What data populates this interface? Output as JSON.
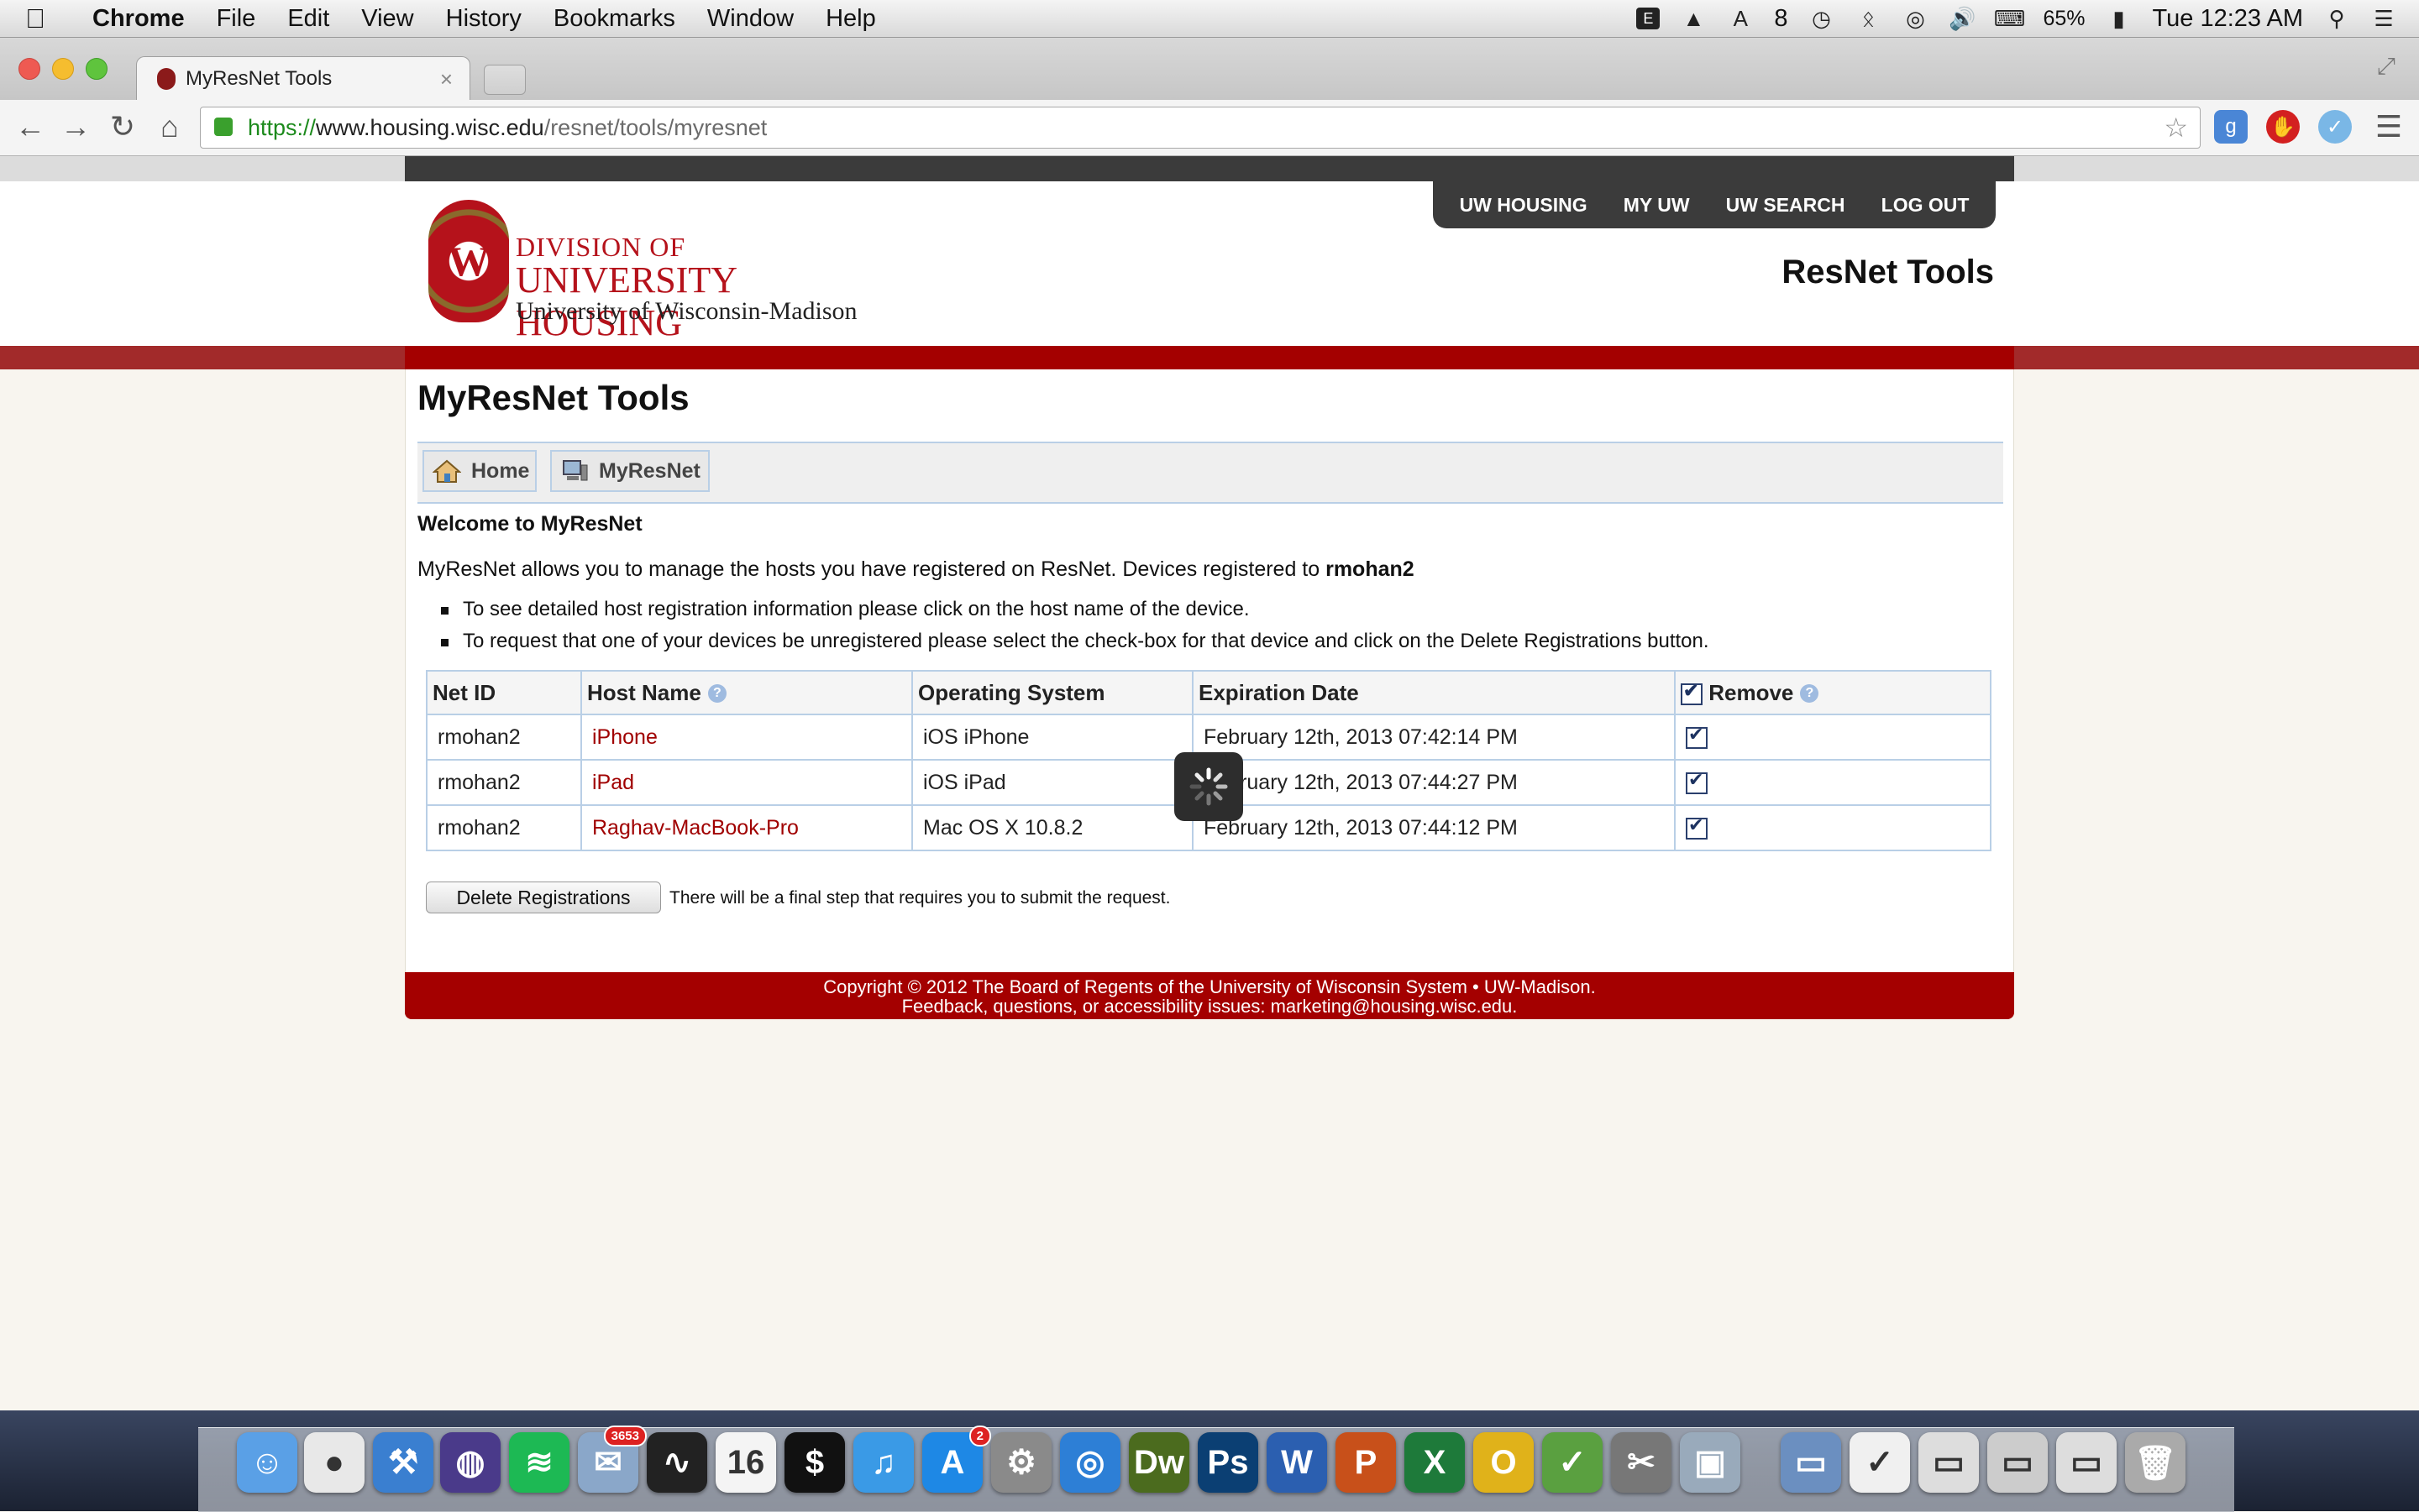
{
  "menubar": {
    "app_name": "Chrome",
    "items": [
      "File",
      "Edit",
      "View",
      "History",
      "Bookmarks",
      "Window",
      "Help"
    ],
    "status": {
      "notif_count": "8",
      "battery": "65%",
      "clock": "Tue 12:23 AM"
    }
  },
  "browser": {
    "tab_title": "MyResNet Tools",
    "url_scheme": "https://",
    "url_host": "www.housing.wisc.edu",
    "url_path": "/resnet/tools/myresnet"
  },
  "header": {
    "nav": [
      "UW HOUSING",
      "MY UW",
      "UW SEARCH",
      "LOG OUT"
    ],
    "logo_line1": "DIVISION OF",
    "logo_line2": "UNIVERSITY HOUSING",
    "logo_line3": "University of Wisconsin-Madison",
    "site_title": "ResNet Tools"
  },
  "main": {
    "heading": "MyResNet Tools",
    "subnav": [
      "Home",
      "MyResNet"
    ],
    "welcome": "Welcome to MyResNet",
    "intro_text": "MyResNet allows you to manage the hosts you have registered on ResNet. Devices registered to ",
    "intro_user": "rmohan2",
    "bullets": [
      "To see detailed host registration information please click on the host name of the device.",
      "To request that one of your devices be unregistered please select the check-box for that device and click on the Delete Registrations button."
    ],
    "table": {
      "headers": [
        "Net ID",
        "Host Name",
        "Operating System",
        "Expiration Date",
        "Remove"
      ],
      "rows": [
        {
          "netid": "rmohan2",
          "host": "iPhone",
          "os": "iOS iPhone",
          "expires": "February 12th, 2013 07:42:14 PM",
          "checked": true
        },
        {
          "netid": "rmohan2",
          "host": "iPad",
          "os": "iOS iPad",
          "expires": "February 12th, 2013 07:44:27 PM",
          "checked": true
        },
        {
          "netid": "rmohan2",
          "host": "Raghav-MacBook-Pro",
          "os": "Mac OS X 10.8.2",
          "expires": "February 12th, 2013 07:44:12 PM",
          "checked": true
        }
      ]
    },
    "delete_button": "Delete Registrations",
    "delete_note": "There will be a final step that requires you to submit the request."
  },
  "footer": {
    "line1": "Copyright © 2012 The Board of Regents of the University of Wisconsin System • UW-Madison.",
    "line2": "Feedback, questions, or accessibility issues: marketing@housing.wisc.edu."
  },
  "dock": {
    "items": [
      "Finder",
      "Chrome",
      "Xcode",
      "Eclipse",
      "Spotify",
      "Mail",
      "Activity Monitor",
      "Calendar",
      "Terminal",
      "iTunes",
      "App Store",
      "System Preferences",
      "Safari",
      "Dw",
      "Ps",
      "W",
      "P",
      "X",
      "O",
      "Stamp",
      "Coda",
      "Preview",
      "Folder",
      "Tasks",
      "Window 1",
      "Window 2",
      "Window 3",
      "Trash"
    ],
    "mail_badge": "3653",
    "appstore_badge": "2",
    "calendar_day": "16"
  },
  "colors": {
    "uw_red": "#a40000",
    "link_red": "#a00000",
    "nav_dark": "#3b3b3b",
    "table_border": "#b9cfe6"
  }
}
